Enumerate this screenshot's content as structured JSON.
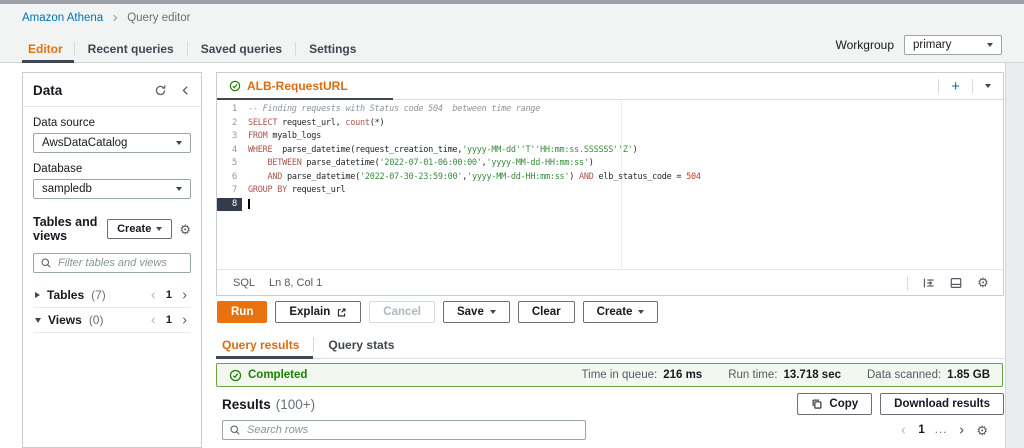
{
  "colors": {
    "accent_orange": "#ec7211",
    "link_blue": "#0073bb",
    "success_green": "#1d8102",
    "banner_bg": "#f2f8ef",
    "banner_border": "#69a33e",
    "header_bg": "#f2f3f3",
    "active_tab_underline": "#414750",
    "code_keyword": "#a7554c",
    "code_string": "#3a8a3d",
    "code_number": "#c7352b",
    "code_comment": "#8d939a",
    "active_line_gutter": "#323c4d"
  },
  "icons": {
    "gear": "⚙",
    "plus": "+"
  },
  "breadcrumb": {
    "root": "Amazon Athena",
    "current": "Query editor"
  },
  "nav": {
    "tabs": [
      "Editor",
      "Recent queries",
      "Saved queries",
      "Settings"
    ],
    "workgroup_label": "Workgroup",
    "workgroup_value": "primary"
  },
  "sidebar": {
    "title": "Data",
    "data_source_label": "Data source",
    "data_source_value": "AwsDataCatalog",
    "database_label": "Database",
    "database_value": "sampledb",
    "tables_views_title": "Tables and views",
    "create_label": "Create",
    "filter_placeholder": "Filter tables and views",
    "tree": [
      {
        "label": "Tables",
        "count": "(7)",
        "page": "1"
      },
      {
        "label": "Views",
        "count": "(0)",
        "page": "1"
      }
    ]
  },
  "editor": {
    "tab_title": "ALB-RequestURL",
    "language": "SQL",
    "cursor_position": "Ln 8, Col 1",
    "code_lines": [
      {
        "n": "1",
        "segs": [
          [
            "comment",
            "-- Finding requests with Status code 504  between time range"
          ]
        ]
      },
      {
        "n": "2",
        "segs": [
          [
            "kw",
            "SELECT"
          ],
          [
            "plain",
            " request_url, "
          ],
          [
            "kw",
            "count"
          ],
          [
            "plain",
            "(*)"
          ]
        ]
      },
      {
        "n": "3",
        "segs": [
          [
            "kw",
            "FROM"
          ],
          [
            "plain",
            " myalb_logs"
          ]
        ]
      },
      {
        "n": "4",
        "segs": [
          [
            "kw",
            "WHERE"
          ],
          [
            "plain",
            "  parse_datetime(request_creation_time,"
          ],
          [
            "str",
            "'yyyy-MM-dd''T''HH:mm:ss.SSSSSS''Z'"
          ],
          [
            "plain",
            ")"
          ]
        ]
      },
      {
        "n": "5",
        "segs": [
          [
            "plain",
            "    "
          ],
          [
            "kw",
            "BETWEEN"
          ],
          [
            "plain",
            " parse_datetime("
          ],
          [
            "str",
            "'2022-07-01-06:00:00'"
          ],
          [
            "plain",
            ","
          ],
          [
            "str",
            "'yyyy-MM-dd-HH:mm:ss'"
          ],
          [
            "plain",
            ")"
          ]
        ]
      },
      {
        "n": "6",
        "segs": [
          [
            "plain",
            "    "
          ],
          [
            "kw",
            "AND"
          ],
          [
            "plain",
            " parse_datetime("
          ],
          [
            "str",
            "'2022-07-30-23:59:00'"
          ],
          [
            "plain",
            ","
          ],
          [
            "str",
            "'yyyy-MM-dd-HH:mm:ss'"
          ],
          [
            "plain",
            ") "
          ],
          [
            "kw",
            "AND"
          ],
          [
            "plain",
            " elb_status_code = "
          ],
          [
            "num",
            "504"
          ]
        ]
      },
      {
        "n": "7",
        "segs": [
          [
            "kw",
            "GROUP BY"
          ],
          [
            "plain",
            " request_url"
          ]
        ]
      },
      {
        "n": "8",
        "segs": [],
        "active": true,
        "cursor": true
      }
    ]
  },
  "actions": {
    "run": "Run",
    "explain": "Explain",
    "cancel": "Cancel",
    "save": "Save",
    "clear": "Clear",
    "create": "Create"
  },
  "results_tabs": {
    "active": "Query results",
    "inactive": "Query stats"
  },
  "status_banner": {
    "state": "Completed",
    "metrics": [
      {
        "label": "Time in queue:",
        "value": "216 ms"
      },
      {
        "label": "Run time:",
        "value": "13.718 sec"
      },
      {
        "label": "Data scanned:",
        "value": "1.85 GB"
      }
    ]
  },
  "results": {
    "title": "Results",
    "count": "(100+)",
    "copy_label": "Copy",
    "download_label": "Download results",
    "search_placeholder": "Search rows",
    "page": "1",
    "ellipsis": "..."
  }
}
